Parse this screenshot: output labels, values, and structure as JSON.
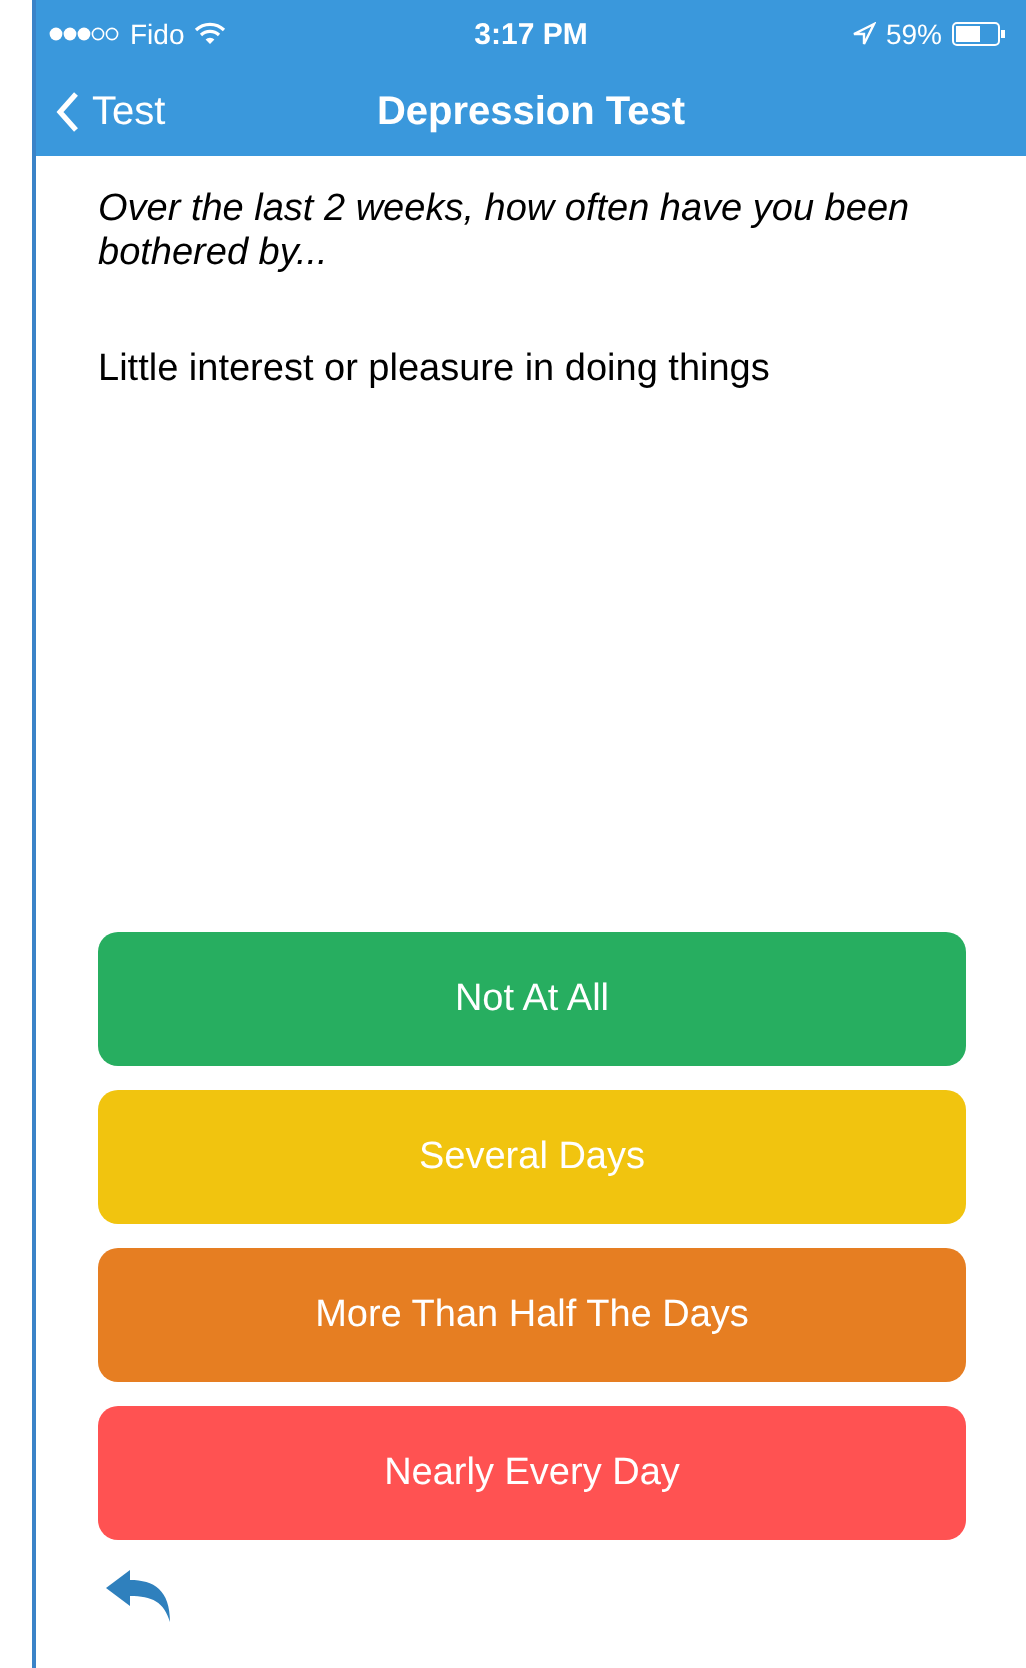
{
  "status_bar": {
    "carrier": "Fido",
    "time": "3:17 PM",
    "battery": "59%"
  },
  "nav": {
    "back": "Test",
    "title": "Depression Test"
  },
  "prompt": "Over the last 2 weeks, how often have you been bothered by...",
  "question": "Little interest or pleasure in doing things",
  "answers": [
    {
      "label": "Not At All",
      "color": "#27ae60"
    },
    {
      "label": "Several Days",
      "color": "#f1c40f"
    },
    {
      "label": "More Than Half The Days",
      "color": "#e67e22"
    },
    {
      "label": "Nearly Every Day",
      "color": "#ff5252"
    }
  ]
}
